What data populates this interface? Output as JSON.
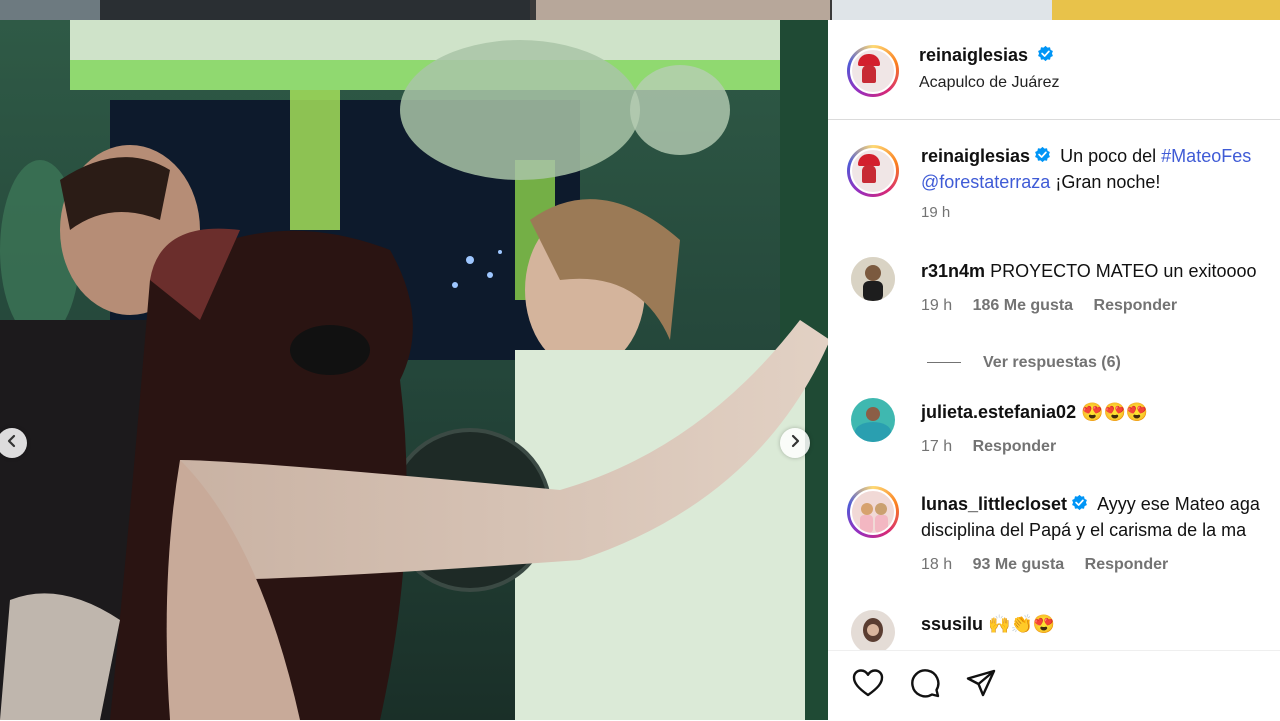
{
  "post": {
    "username": "reinaiglesias",
    "location": "Acapulco de Juárez",
    "caption": {
      "username": "reinaiglesias",
      "text_before": "Un poco del ",
      "hashtag": "#MateoFes",
      "mention": "@forestaterraza",
      "text_after": " ¡Gran noche!",
      "time": "19 h"
    }
  },
  "comments": [
    {
      "username": "r31n4m",
      "text": "PROYECTO MATEO un exitoooo",
      "time": "19 h",
      "likes": "186 Me gusta",
      "reply": "Responder",
      "verified": false
    },
    {
      "username": "julieta.estefania02",
      "text": "😍😍😍",
      "time": "17 h",
      "likes": "",
      "reply": "Responder",
      "verified": false
    },
    {
      "username": "lunas_littlecloset",
      "text": "Ayyy ese Mateo aga",
      "text_line2": "disciplina del Papá y el carisma de la ma",
      "time": "18 h",
      "likes": "93 Me gusta",
      "reply": "Responder",
      "verified": true
    },
    {
      "username": "ssusilu",
      "text": "🙌👏😍",
      "verified": false
    }
  ],
  "view_replies": "Ver respuestas (6)",
  "icons": {
    "like": "heart-icon",
    "comment": "comment-icon",
    "share": "share-icon",
    "verified": "verified-badge-icon",
    "prev": "chevron-left-icon",
    "next": "chevron-right-icon"
  },
  "colors": {
    "link": "#3f5bd6",
    "verified": "#0095f6",
    "muted": "#737373"
  }
}
